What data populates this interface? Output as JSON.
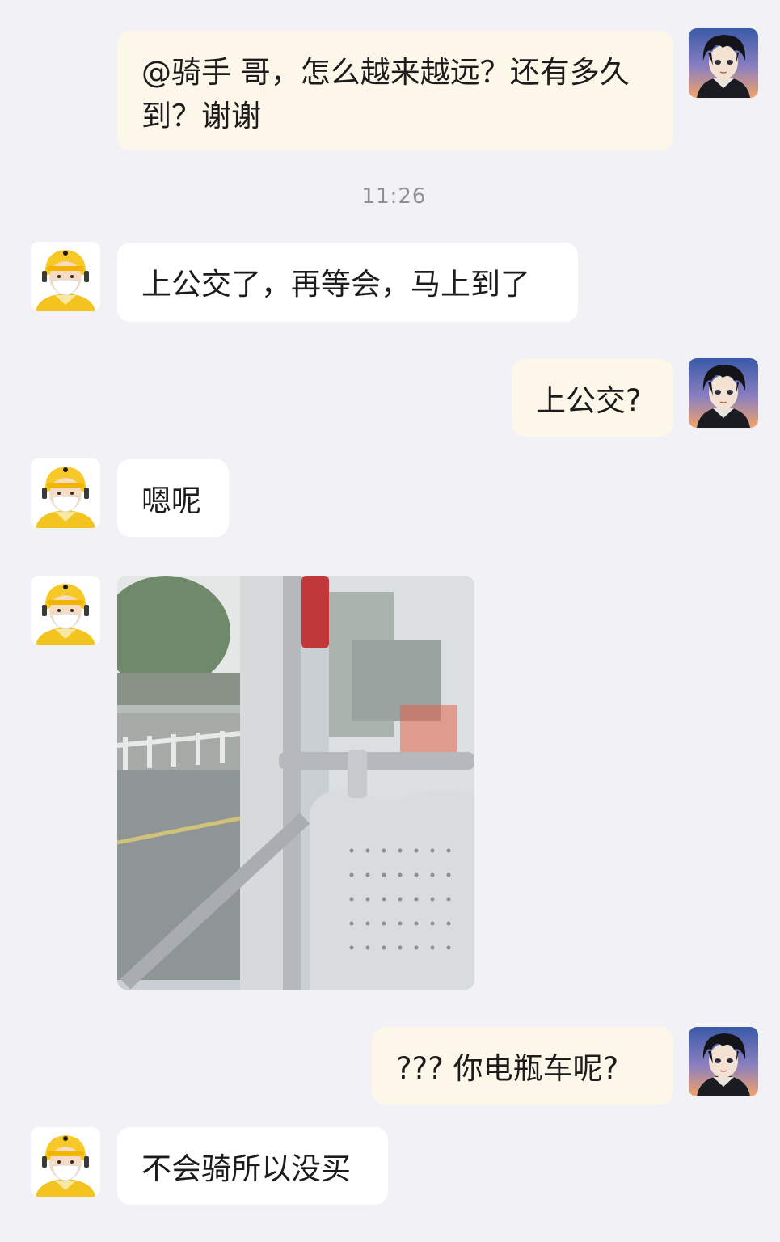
{
  "messages": [
    {
      "sender": "me",
      "text": "@骑手 哥，怎么越来越远？还有多久到？谢谢"
    },
    {
      "sender": "rider",
      "text": "上公交了，再等会，马上到了"
    },
    {
      "sender": "me",
      "text": "上公交?"
    },
    {
      "sender": "rider",
      "text": "嗯呢"
    },
    {
      "sender": "rider",
      "type": "image",
      "image_description": "bus-interior-photo"
    },
    {
      "sender": "me",
      "text": "??? 你电瓶车呢?"
    },
    {
      "sender": "rider",
      "text": "不会骑所以没买"
    }
  ],
  "timestamp": "11:26",
  "colors": {
    "background": "#f2f2f6",
    "my_bubble": "#fdf7ea",
    "their_bubble": "#ffffff",
    "rider_helmet": "#f7c928"
  },
  "icons": {
    "my_avatar": "anime-boy-avatar",
    "rider_avatar": "delivery-rider-avatar"
  }
}
